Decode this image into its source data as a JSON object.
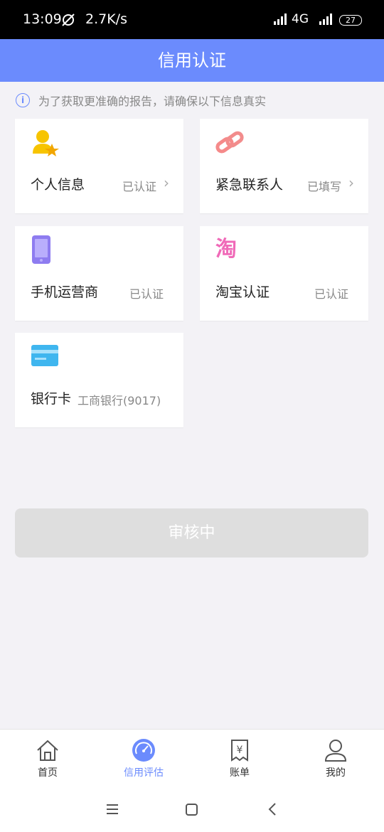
{
  "status_bar": {
    "time": "13:09",
    "speed": "2.7K/s",
    "network": "4G",
    "battery": "27"
  },
  "header": {
    "title": "信用认证"
  },
  "notice": {
    "text": "为了获取更准确的报告，请确保以下信息真实"
  },
  "cards": {
    "personal": {
      "title": "个人信息",
      "status": "已认证"
    },
    "emergency": {
      "title": "紧急联系人",
      "status": "已填写"
    },
    "operator": {
      "title": "手机运营商",
      "status": "已认证"
    },
    "taobao": {
      "title": "淘宝认证",
      "status": "已认证",
      "icon_text": "淘"
    },
    "bank": {
      "title": "银行卡",
      "bank_info": "工商银行(9017)"
    }
  },
  "submit_button": {
    "label": "审核中"
  },
  "tabs": [
    {
      "label": "首页"
    },
    {
      "label": "信用评估"
    },
    {
      "label": "账单"
    },
    {
      "label": "我的"
    }
  ],
  "colors": {
    "accent": "#6b8bfd",
    "background": "#f3f2f6"
  }
}
